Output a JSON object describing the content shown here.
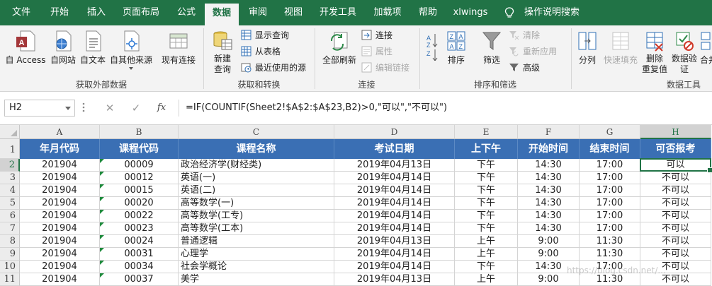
{
  "tabs": [
    "文件",
    "开始",
    "插入",
    "页面布局",
    "公式",
    "数据",
    "审阅",
    "视图",
    "开发工具",
    "加载项",
    "帮助",
    "xlwings",
    "操作说明搜索"
  ],
  "active_tab": "数据",
  "ribbon": {
    "get_external": {
      "label": "获取外部数据",
      "access": "自 Access",
      "web": "自网站",
      "text": "自文本",
      "other": "自其他来源",
      "existing": "现有连接"
    },
    "get_transform": {
      "label": "获取和转换",
      "new_query_line1": "新建",
      "new_query_line2": "查询",
      "show_queries": "显示查询",
      "from_table": "从表格",
      "recent_sources": "最近使用的源"
    },
    "connections": {
      "label": "连接",
      "refresh_all": "全部刷新",
      "connections": "连接",
      "properties": "属性",
      "edit_links": "编辑链接"
    },
    "sort_filter": {
      "label": "排序和筛选",
      "sort": "排序",
      "filter": "筛选",
      "clear": "清除",
      "reapply": "重新应用",
      "advanced": "高级"
    },
    "data_tools": {
      "label": "数据工具",
      "text_to_columns": "分列",
      "flash_fill": "快速填充",
      "remove_dup_line1": "删除",
      "remove_dup_line2": "重复值",
      "validation_line1": "数据验",
      "validation_line2": "证",
      "consolidate": "合并"
    }
  },
  "formula_bar": {
    "name_box": "H2",
    "cancel": "✕",
    "enter": "✓",
    "fx": "fx",
    "formula": "=IF(COUNTIF(Sheet2!$A$2:$A$23,B2)>0,\"可以\",\"不可以\")"
  },
  "sheet": {
    "columns": [
      "A",
      "B",
      "C",
      "D",
      "E",
      "F",
      "G",
      "H"
    ],
    "row_numbers": [
      "1",
      "2",
      "3",
      "4",
      "5",
      "6",
      "7",
      "8",
      "9",
      "10",
      "11"
    ],
    "header_row": [
      "年月代码",
      "课程代码",
      "课程名称",
      "考试日期",
      "上下午",
      "开始时间",
      "结束时间",
      "可否报考"
    ],
    "rows": [
      [
        "201904",
        "00009",
        "政治经济学(财经类)",
        "2019年04月13日",
        "下午",
        "14:30",
        "17:00",
        "可以"
      ],
      [
        "201904",
        "00012",
        "英语(一)",
        "2019年04月14日",
        "下午",
        "14:30",
        "17:00",
        "不可以"
      ],
      [
        "201904",
        "00015",
        "英语(二)",
        "2019年04月14日",
        "下午",
        "14:30",
        "17:00",
        "不可以"
      ],
      [
        "201904",
        "00020",
        "高等数学(一)",
        "2019年04月14日",
        "下午",
        "14:30",
        "17:00",
        "不可以"
      ],
      [
        "201904",
        "00022",
        "高等数学(工专)",
        "2019年04月14日",
        "下午",
        "14:30",
        "17:00",
        "不可以"
      ],
      [
        "201904",
        "00023",
        "高等数学(工本)",
        "2019年04月14日",
        "下午",
        "14:30",
        "17:00",
        "不可以"
      ],
      [
        "201904",
        "00024",
        "普通逻辑",
        "2019年04月13日",
        "上午",
        "9:00",
        "11:30",
        "不可以"
      ],
      [
        "201904",
        "00031",
        "心理学",
        "2019年04月14日",
        "上午",
        "9:00",
        "11:30",
        "不可以"
      ],
      [
        "201904",
        "00034",
        "社会学概论",
        "2019年04月14日",
        "下午",
        "14:30",
        "17:00",
        "不可以"
      ],
      [
        "201904",
        "00037",
        "美学",
        "2019年04月13日",
        "上午",
        "9:00",
        "11:30",
        "不可以"
      ]
    ],
    "watermark": "https://blog.csdn.net/...",
    "colors": {
      "accent": "#217346",
      "header_fill": "#3a6fb4"
    }
  }
}
